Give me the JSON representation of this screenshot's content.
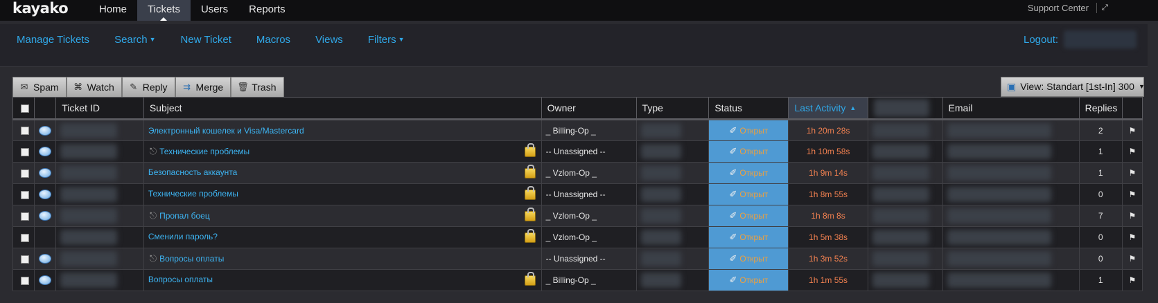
{
  "topbar": {
    "logo": "kayako",
    "nav": [
      {
        "label": "Home",
        "active": false
      },
      {
        "label": "Tickets",
        "active": true
      },
      {
        "label": "Users",
        "active": false
      },
      {
        "label": "Reports",
        "active": false
      }
    ],
    "support_center": "Support Center",
    "expand_icon": "expand-icon"
  },
  "subnav": {
    "manage_tickets": "Manage Tickets",
    "search": "Search",
    "new_ticket": "New Ticket",
    "macros": "Macros",
    "views": "Views",
    "filters": "Filters",
    "logout": "Logout:"
  },
  "toolbar": {
    "spam": "Spam",
    "watch": "Watch",
    "reply": "Reply",
    "merge": "Merge",
    "trash": "Trash",
    "view": "View: Standart [1st-In] 300"
  },
  "columns": {
    "ticket_id": "Ticket ID",
    "subject": "Subject",
    "owner": "Owner",
    "type": "Type",
    "status": "Status",
    "last_activity": "Last Activity",
    "email": "Email",
    "replies": "Replies"
  },
  "colors": {
    "accent": "#30a8e8",
    "status_bg": "#4f9ad3",
    "status_text": "#f0a03c",
    "activity_text": "#f08050"
  },
  "rows": [
    {
      "bubble": true,
      "attach": false,
      "lock": false,
      "subject": "Электронный кошелек и Visa/Mastercard",
      "owner": "_ Billing-Op _",
      "status": "Открыт",
      "activity": "1h 20m 28s",
      "replies": "2"
    },
    {
      "bubble": true,
      "attach": true,
      "lock": true,
      "subject": "Технические проблемы",
      "owner": "-- Unassigned --",
      "status": "Открыт",
      "activity": "1h 10m 58s",
      "replies": "1"
    },
    {
      "bubble": true,
      "attach": false,
      "lock": true,
      "subject": "Безопасность аккаунта",
      "owner": "_ Vzlom-Op _",
      "status": "Открыт",
      "activity": "1h 9m 14s",
      "replies": "1"
    },
    {
      "bubble": true,
      "attach": false,
      "lock": true,
      "subject": "Технические проблемы",
      "owner": "-- Unassigned --",
      "status": "Открыт",
      "activity": "1h 8m 55s",
      "replies": "0"
    },
    {
      "bubble": true,
      "attach": true,
      "lock": true,
      "subject": "Пропал боец",
      "owner": "_ Vzlom-Op _",
      "status": "Открыт",
      "activity": "1h 8m 8s",
      "replies": "7"
    },
    {
      "bubble": false,
      "attach": false,
      "lock": true,
      "subject": "Сменили пароль?",
      "owner": "_ Vzlom-Op _",
      "status": "Открыт",
      "activity": "1h 5m 38s",
      "replies": "0"
    },
    {
      "bubble": true,
      "attach": true,
      "lock": false,
      "subject": "Вопросы оплаты",
      "owner": "-- Unassigned --",
      "status": "Открыт",
      "activity": "1h 3m 52s",
      "replies": "0"
    },
    {
      "bubble": true,
      "attach": false,
      "lock": true,
      "subject": "Вопросы оплаты",
      "owner": "_ Billing-Op _",
      "status": "Открыт",
      "activity": "1h 1m 55s",
      "replies": "1"
    }
  ]
}
